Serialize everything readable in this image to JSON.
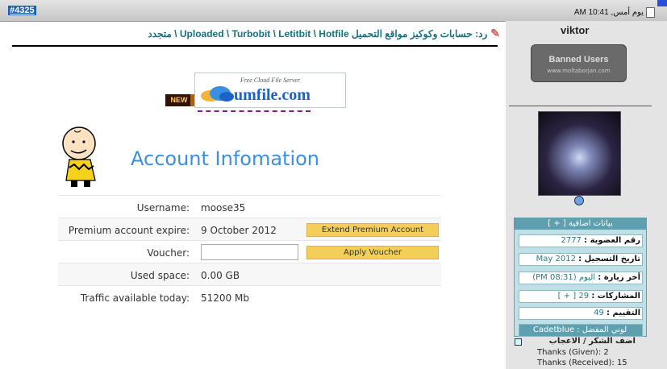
{
  "post": {
    "number": "#4325",
    "date": "يوم أمس, 10:41 AM",
    "reply_title": "رد: حسابات وكوكيز مواقع التحميل Uploaded \\ Turbobit \\ Letitbit \\ Hotfile \\ متجدد"
  },
  "banner": {
    "new_label": "NEW",
    "logo_tagline": "Free Cloud File Server",
    "logo_name": "umfile.com"
  },
  "account": {
    "title": "Account Infomation",
    "rows": [
      {
        "label": "Username:",
        "value": "moose35"
      },
      {
        "label": "Premium account expire:",
        "value": "9 October 2012",
        "button": "Extend Premium Account"
      },
      {
        "label": "Voucher:",
        "value": "",
        "button": "Apply Voucher"
      },
      {
        "label": "Used space:",
        "value": "0.00 GB"
      },
      {
        "label": "Traffic available today:",
        "value": "51200 Mb"
      }
    ]
  },
  "user": {
    "name": "viktor",
    "rank_line1": "Banned Users",
    "rank_line2": "www.moltaborjan.com",
    "info_header": "بيانات اضافية [ + ]",
    "info": [
      {
        "key": "رقم العضوية :",
        "value": "2777"
      },
      {
        "key": "تاريخ التسجيل :",
        "value": "May 2012"
      },
      {
        "key": "أخر زيارة :",
        "value": "اليوم (08:31 PM)"
      },
      {
        "key": "المشاركات :",
        "value": "29 [ + ]"
      },
      {
        "key": "التقييم :",
        "value": "49"
      }
    ],
    "fav_color": "لوني المفضل : Cadetblue",
    "thanks_header": "اضف الشكر / الاعجاب",
    "thanks_given": "Thanks (Given): 2",
    "thanks_received": "Thanks (Received): 15"
  },
  "colors": {
    "title_blue": "#3d8fe0",
    "button_yellow": "#f3cf5a",
    "info_teal": "#5ea0af"
  }
}
